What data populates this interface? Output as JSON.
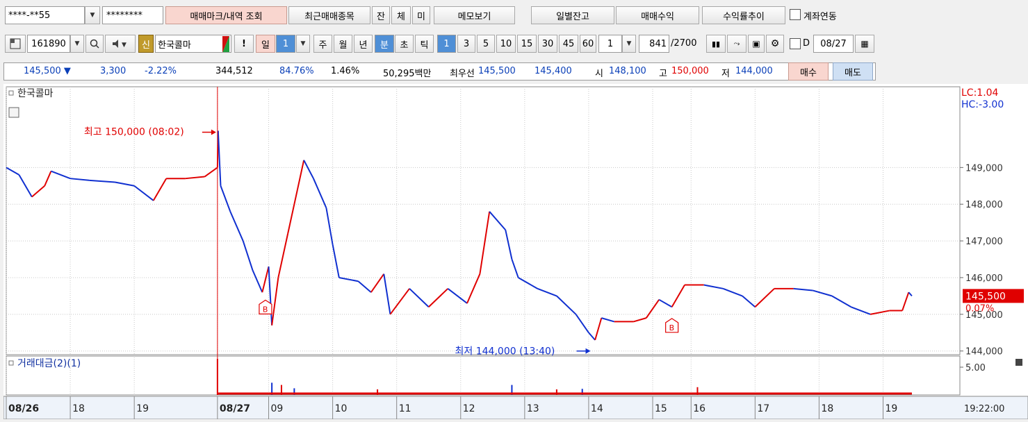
{
  "toolbar1": {
    "account": "****-**55",
    "password": "********",
    "btn_mark": "매매마크/내역 조회",
    "btn_recent": "최근매매종목",
    "btn_jan": "잔",
    "btn_che": "체",
    "btn_mi": "미",
    "btn_memo": "메모보기",
    "btn_daily": "일별잔고",
    "btn_profit": "매매수익",
    "btn_trend": "수익률추이",
    "link_label": "계좌연동"
  },
  "toolbar2": {
    "code": "161890",
    "badge_new": "신",
    "stock_name": "한국콜마",
    "excl": "!",
    "periods": [
      "일",
      "주",
      "월",
      "년",
      "분",
      "초",
      "틱"
    ],
    "day_num": "1",
    "intervals": [
      "1",
      "3",
      "5",
      "10",
      "15",
      "30",
      "45",
      "60"
    ],
    "custom_interval": "1",
    "count": "841",
    "count_max": "/2700",
    "d_label": "D",
    "date": "08/27"
  },
  "ticker": {
    "price": "145,500",
    "change": "3,300",
    "change_pct": "-2.22%",
    "volume": "344,512",
    "ratio1": "84.76%",
    "ratio2": "1.46%",
    "amount": "50,295백만",
    "best_label": "최우선",
    "ask": "145,500",
    "bid": "145,400",
    "open_label": "시",
    "open": "148,100",
    "high_label": "고",
    "high": "150,000",
    "low_label": "저",
    "low": "144,000",
    "buy_btn": "매수",
    "sell_btn": "매도"
  },
  "chart_labels": {
    "stock_tag": "한국콜마",
    "high_annot": "최고 150,000 (08:02)",
    "low_annot": "최저 144,000 (13:40)",
    "lc": "LC:1.04",
    "hc": "HC:-3.00",
    "current_price": "145,500",
    "current_pct": "0.07%",
    "volume_title": "거래대금(2)(1)",
    "volume_tick": "5.00",
    "time_label": "19:22:00",
    "buy_marker": "B"
  },
  "colors": {
    "up": "#e00000",
    "down": "#1030d0",
    "grid": "#c8c8c8",
    "accent_blue": "#4f8fd6"
  },
  "chart_data": {
    "type": "line",
    "price_ticks": [
      {
        "value": 149000,
        "label": "149,000"
      },
      {
        "value": 148000,
        "label": "148,000"
      },
      {
        "value": 147000,
        "label": "147,000"
      },
      {
        "value": 146000,
        "label": "146,000"
      },
      {
        "value": 145000,
        "label": "145,000"
      },
      {
        "value": 144000,
        "label": "144,000"
      }
    ],
    "ylim": [
      143900,
      151200
    ],
    "x_labels": [
      {
        "t": 0,
        "label": "08/26",
        "bold": true
      },
      {
        "t": 1,
        "label": "18"
      },
      {
        "t": 2,
        "label": "19"
      },
      {
        "t": 3.3,
        "label": "08/27",
        "bold": true
      },
      {
        "t": 4.1,
        "label": "09"
      },
      {
        "t": 5.1,
        "label": "10"
      },
      {
        "t": 6.1,
        "label": "11"
      },
      {
        "t": 7.1,
        "label": "12"
      },
      {
        "t": 8.1,
        "label": "13"
      },
      {
        "t": 9.1,
        "label": "14"
      },
      {
        "t": 10.1,
        "label": "15"
      },
      {
        "t": 10.7,
        "label": "16"
      },
      {
        "t": 11.7,
        "label": "17"
      },
      {
        "t": 12.7,
        "label": "18"
      },
      {
        "t": 13.7,
        "label": "19"
      }
    ],
    "x_range": [
      0,
      14.9
    ],
    "price_series": [
      [
        0.0,
        149000
      ],
      [
        0.2,
        148800
      ],
      [
        0.4,
        148200
      ],
      [
        0.6,
        148500
      ],
      [
        0.7,
        148900
      ],
      [
        1.0,
        148700
      ],
      [
        1.3,
        148650
      ],
      [
        1.7,
        148600
      ],
      [
        2.0,
        148500
      ],
      [
        2.3,
        148100
      ],
      [
        2.5,
        148700
      ],
      [
        2.8,
        148700
      ],
      [
        3.1,
        148750
      ],
      [
        3.3,
        149000
      ],
      [
        3.31,
        150000
      ],
      [
        3.35,
        148500
      ],
      [
        3.5,
        147800
      ],
      [
        3.7,
        147000
      ],
      [
        3.85,
        146200
      ],
      [
        4.0,
        145600
      ],
      [
        4.1,
        146300
      ],
      [
        4.15,
        144700
      ],
      [
        4.25,
        146000
      ],
      [
        4.4,
        147200
      ],
      [
        4.55,
        148400
      ],
      [
        4.65,
        149200
      ],
      [
        4.8,
        148700
      ],
      [
        5.0,
        147900
      ],
      [
        5.1,
        146900
      ],
      [
        5.2,
        146000
      ],
      [
        5.5,
        145900
      ],
      [
        5.7,
        145600
      ],
      [
        5.9,
        146100
      ],
      [
        6.0,
        145000
      ],
      [
        6.3,
        145700
      ],
      [
        6.6,
        145200
      ],
      [
        6.9,
        145700
      ],
      [
        7.2,
        145300
      ],
      [
        7.4,
        146100
      ],
      [
        7.55,
        147800
      ],
      [
        7.8,
        147300
      ],
      [
        7.9,
        146500
      ],
      [
        8.0,
        146000
      ],
      [
        8.3,
        145700
      ],
      [
        8.6,
        145500
      ],
      [
        8.9,
        145000
      ],
      [
        9.1,
        144500
      ],
      [
        9.2,
        144300
      ],
      [
        9.3,
        144900
      ],
      [
        9.5,
        144800
      ],
      [
        9.8,
        144800
      ],
      [
        10.0,
        144900
      ],
      [
        10.2,
        145400
      ],
      [
        10.4,
        145200
      ],
      [
        10.6,
        145800
      ],
      [
        10.9,
        145800
      ],
      [
        11.2,
        145700
      ],
      [
        11.5,
        145500
      ],
      [
        11.7,
        145200
      ],
      [
        12.0,
        145700
      ],
      [
        12.3,
        145700
      ],
      [
        12.6,
        145650
      ],
      [
        12.9,
        145500
      ],
      [
        13.2,
        145200
      ],
      [
        13.5,
        145000
      ],
      [
        13.8,
        145100
      ],
      [
        14.0,
        145100
      ],
      [
        14.1,
        145600
      ],
      [
        14.15,
        145500
      ]
    ],
    "volume_ylim": [
      0,
      6
    ],
    "volume_spikes": [
      {
        "t": 3.3,
        "v": 6.5
      },
      {
        "t": 4.15,
        "v": 2.2
      },
      {
        "t": 4.3,
        "v": 1.8
      },
      {
        "t": 4.5,
        "v": 1.2
      },
      {
        "t": 5.8,
        "v": 1.0
      },
      {
        "t": 7.9,
        "v": 1.8
      },
      {
        "t": 8.6,
        "v": 1.0
      },
      {
        "t": 9.0,
        "v": 1.1
      },
      {
        "t": 10.8,
        "v": 1.4
      }
    ],
    "buy_markers": [
      {
        "t": 4.05,
        "p": 145500
      },
      {
        "t": 10.4,
        "p": 145000
      }
    ],
    "high_point": {
      "t": 3.3,
      "p": 150000
    },
    "low_point": {
      "t": 9.15,
      "p": 144000
    }
  }
}
